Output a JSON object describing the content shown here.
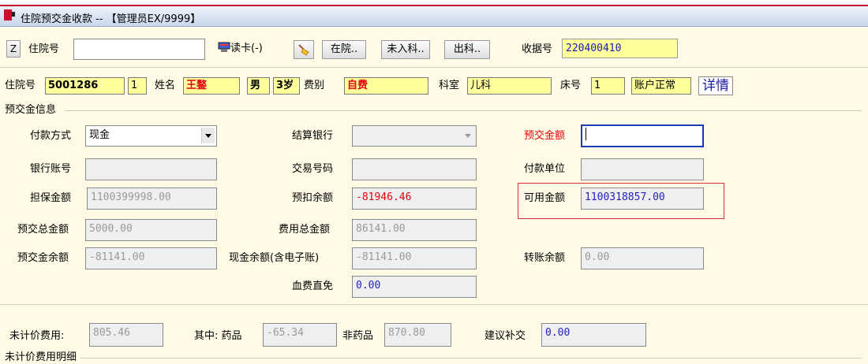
{
  "window": {
    "title": "住院预交金收款 -- 【管理员EX/9999】"
  },
  "toolbar": {
    "z_label": "Z",
    "hospital_no_label": "住院号",
    "hospital_no_value": "",
    "read_card_label": "读卡(-)",
    "in_hospital_label": "在院..",
    "not_admitted_label": "未入科..",
    "discharged_label": "出科..",
    "receipt_no_label": "收据号",
    "receipt_no_value": "220400410"
  },
  "patient": {
    "hospital_no_label": "住院号",
    "hospital_no": "5001286",
    "visit_count": "1",
    "name_label": "姓名",
    "name": "王鍪",
    "sex": "男",
    "age": "3岁",
    "fee_type_label": "费别",
    "fee_type": "自费",
    "dept_label": "科室",
    "dept": "儿科",
    "bed_label": "床号",
    "bed": "1",
    "account_status": "账户正常",
    "detail_label": "详情"
  },
  "deposit": {
    "section_title": "预交金信息",
    "pay_method_label": "付款方式",
    "pay_method": "现金",
    "settle_bank_label": "结算银行",
    "settle_bank": "",
    "deposit_amount_label": "预交金额",
    "deposit_amount": "",
    "bank_account_label": "银行账号",
    "bank_account": "",
    "trade_no_label": "交易号码",
    "trade_no": "",
    "payer_unit_label": "付款单位",
    "payer_unit": "",
    "guarantee_label": "担保金额",
    "guarantee": "1100399998.00",
    "prededuct_label": "预扣余额",
    "prededuct": "-81946.46",
    "available_label": "可用金额",
    "available": "1100318857.00",
    "total_deposit_label": "预交总金额",
    "total_deposit": "5000.00",
    "total_fee_label": "费用总金额",
    "total_fee": "86141.00",
    "deposit_balance_label": "预交金余额",
    "deposit_balance": "-81141.00",
    "cash_balance_label": "现金余额(含电子账)",
    "cash_balance": "-81141.00",
    "transfer_balance_label": "转账余额",
    "transfer_balance": "0.00",
    "blood_fee_label": "血费直免",
    "blood_fee": "0.00"
  },
  "unpriced": {
    "fee_label": "未计价费用:",
    "fee": "805.46",
    "drug_label": "其中: 药品",
    "drug": "-65.34",
    "nondrug_label": "非药品",
    "nondrug": "870.80",
    "suggest_label": "建议补交",
    "suggest": "0.00",
    "detail_title": "未计价费用明细"
  }
}
